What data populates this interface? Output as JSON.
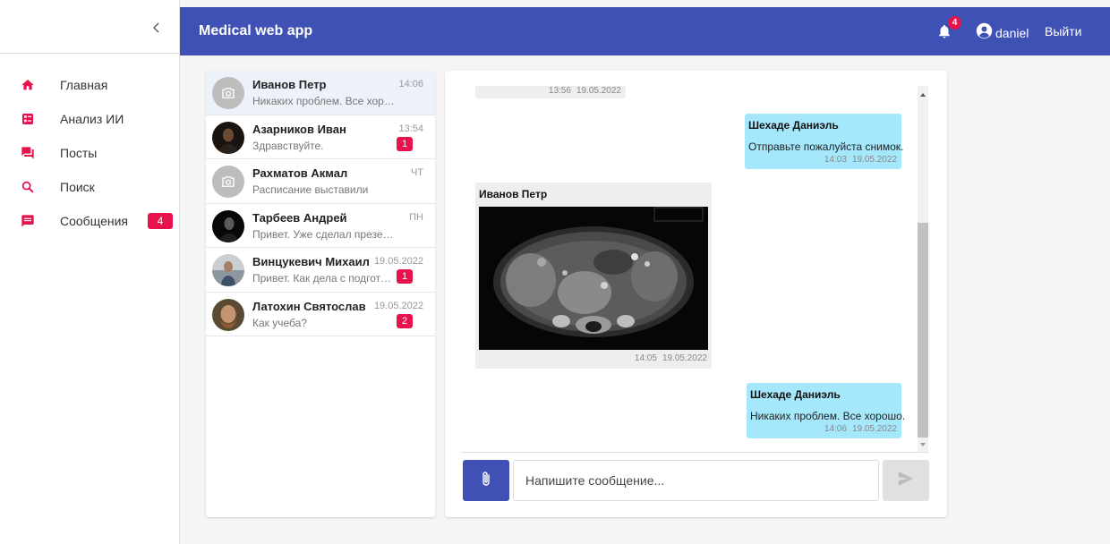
{
  "sidebar": {
    "collapse_icon": "chevron-left-icon",
    "accent_color": "#e8124c",
    "items": [
      {
        "label": "Главная",
        "icon": "home-icon"
      },
      {
        "label": "Анализ ИИ",
        "icon": "dashboard-icon"
      },
      {
        "label": "Посты",
        "icon": "forum-icon"
      },
      {
        "label": "Поиск",
        "icon": "search-icon"
      },
      {
        "label": "Сообщения",
        "icon": "message-icon",
        "badge": "4"
      }
    ]
  },
  "header": {
    "title": "Medical web app",
    "bg_color": "#3f51b5",
    "notifications_count": "4",
    "username": "daniel",
    "logout_label": "Выйти"
  },
  "chats": [
    {
      "name": "Иванов Петр",
      "preview": "Никаких проблем. Все хорошо.",
      "time": "14:06",
      "unread": null,
      "avatar": "camera-placeholder",
      "active": true
    },
    {
      "name": "Азарников Иван",
      "preview": "Здравствуйте.",
      "time": "13:54",
      "unread": "1",
      "avatar": "photo"
    },
    {
      "name": "Рахматов Акмал",
      "preview": "Расписание выставили",
      "time": "ЧТ",
      "unread": null,
      "avatar": "camera-placeholder"
    },
    {
      "name": "Тарбеев Андрей",
      "preview": "Привет. Уже сделал презентацию?",
      "time": "ПН",
      "unread": null,
      "avatar": "photo"
    },
    {
      "name": "Винцукевич Михаил",
      "preview": "Привет. Как дела с подготовкой?",
      "time": "19.05.2022",
      "unread": "1",
      "avatar": "photo"
    },
    {
      "name": "Латохин Святослав",
      "preview": "Как учеба?",
      "time": "19.05.2022",
      "unread": "2",
      "avatar": "photo"
    }
  ],
  "conversation": {
    "messages": [
      {
        "direction": "in",
        "author": "",
        "text": "",
        "time": "13:56",
        "date": "19.05.2022"
      },
      {
        "direction": "out",
        "author": "Шехаде Даниэль",
        "text": "Отправьте пожалуйста снимок.",
        "time": "14:03",
        "date": "19.05.2022"
      },
      {
        "direction": "in",
        "author": "Иванов Петр",
        "text": "",
        "attachment": "mri-scan-image",
        "time": "14:05",
        "date": "19.05.2022"
      },
      {
        "direction": "out",
        "author": "Шехаде Даниэль",
        "text": "Никаких проблем. Все хорошо.",
        "time": "14:06",
        "date": "19.05.2022"
      }
    ],
    "incoming_color": "#eeeeee",
    "outgoing_color": "#a5e8fc"
  },
  "composer": {
    "placeholder": "Напишите сообщение...",
    "attach_icon": "paperclip-icon",
    "send_icon": "send-icon"
  }
}
